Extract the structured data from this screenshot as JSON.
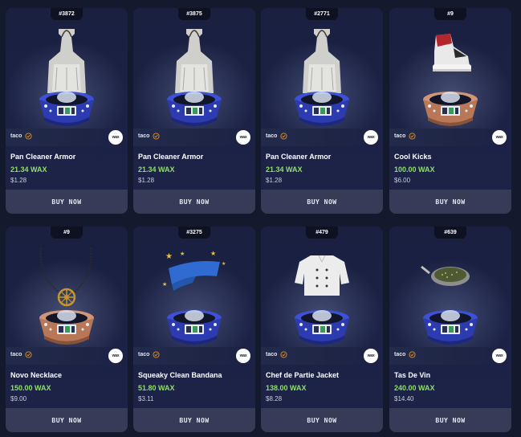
{
  "cards": [
    {
      "mint": "#3872",
      "collection": "taco",
      "name": "Pan Cleaner Armor",
      "price_wax": "21.34 WAX",
      "price_usd": "$1.28",
      "buy_label": "BUY NOW",
      "wax_logo": "wax",
      "item_icon": "apron-icon",
      "stand": "blue"
    },
    {
      "mint": "#3875",
      "collection": "taco",
      "name": "Pan Cleaner Armor",
      "price_wax": "21.34 WAX",
      "price_usd": "$1.28",
      "buy_label": "BUY NOW",
      "wax_logo": "wax",
      "item_icon": "apron-icon",
      "stand": "blue"
    },
    {
      "mint": "#2771",
      "collection": "taco",
      "name": "Pan Cleaner Armor",
      "price_wax": "21.34 WAX",
      "price_usd": "$1.28",
      "buy_label": "BUY NOW",
      "wax_logo": "wax",
      "item_icon": "apron-icon",
      "stand": "blue"
    },
    {
      "mint": "#9",
      "collection": "taco",
      "name": "Cool Kicks",
      "price_wax": "100.00 WAX",
      "price_usd": "$6.00",
      "buy_label": "BUY NOW",
      "wax_logo": "wax",
      "item_icon": "sneaker-icon",
      "stand": "copper"
    },
    {
      "mint": "#9",
      "collection": "taco",
      "name": "Novo Necklace",
      "price_wax": "150.00 WAX",
      "price_usd": "$9.00",
      "buy_label": "BUY NOW",
      "wax_logo": "wax",
      "item_icon": "necklace-icon",
      "stand": "copper"
    },
    {
      "mint": "#3275",
      "collection": "taco",
      "name": "Squeaky Clean Bandana",
      "price_wax": "51.80 WAX",
      "price_usd": "$3.11",
      "buy_label": "BUY NOW",
      "wax_logo": "wax",
      "item_icon": "bandana-icon",
      "stand": "blue"
    },
    {
      "mint": "#479",
      "collection": "taco",
      "name": "Chef de Partie Jacket",
      "price_wax": "138.00 WAX",
      "price_usd": "$8.28",
      "buy_label": "BUY NOW",
      "wax_logo": "wax",
      "item_icon": "chef-jacket-icon",
      "stand": "blue"
    },
    {
      "mint": "#639",
      "collection": "taco",
      "name": "Tas De Vin",
      "price_wax": "240.00 WAX",
      "price_usd": "$14.40",
      "buy_label": "BUY NOW",
      "wax_logo": "wax",
      "item_icon": "wine-cup-icon",
      "stand": "blue"
    }
  ],
  "colors": {
    "background": "#131a2e",
    "card": "#1b2245",
    "wax_price": "#8ee06a",
    "button": "#363c58",
    "verified": "#e0902c"
  }
}
